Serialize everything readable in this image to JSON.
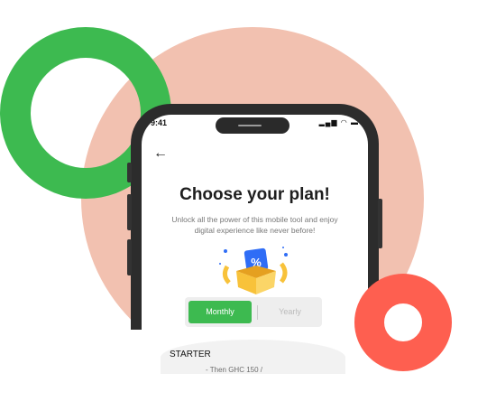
{
  "status": {
    "time": "9:41",
    "icons": "signal wifi battery"
  },
  "screen": {
    "back_icon": "arrow-left",
    "title": "Choose your plan!",
    "subtitle": "Unlock all the power of this mobile tool and enjoy digital experience like never before!",
    "gift_badge": "%",
    "toggle": {
      "monthly": "Monthly",
      "yearly": "Yearly",
      "selected": "Monthly"
    },
    "plan": {
      "name": "STARTER",
      "price_partial": "- Then GHC 150 /"
    }
  },
  "colors": {
    "green": "#3dba50",
    "red": "#fe5f50",
    "salmon": "#f2c1b0",
    "blue": "#2f6df6",
    "gold": "#f8c23a"
  }
}
